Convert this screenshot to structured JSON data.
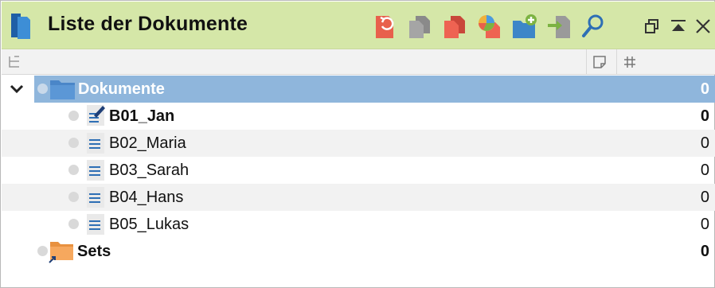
{
  "window": {
    "title": "Liste der Dokumente"
  },
  "toolbar": {
    "icons": [
      "document-activate-icon",
      "copy-documents-icon",
      "multiple-documents-icon",
      "pie-chart-document-icon",
      "new-folder-icon",
      "import-icon",
      "search-icon"
    ]
  },
  "window_controls": {
    "icons": [
      "restore-window-icon",
      "collapse-up-icon",
      "close-icon"
    ]
  },
  "columns": {
    "icons": [
      "tree-structure-icon",
      "memo-icon",
      "hash-icon"
    ]
  },
  "tree": {
    "root": {
      "label": "Dokumente",
      "count": "0",
      "expanded": true,
      "selected": true
    },
    "documents": [
      {
        "label": "B01_Jan",
        "count": "0",
        "bold": true,
        "editing": true
      },
      {
        "label": "B02_Maria",
        "count": "0",
        "bold": false
      },
      {
        "label": "B03_Sarah",
        "count": "0",
        "bold": false
      },
      {
        "label": "B04_Hans",
        "count": "0",
        "bold": false
      },
      {
        "label": "B05_Lukas",
        "count": "0",
        "bold": false
      }
    ],
    "sets": {
      "label": "Sets",
      "count": "0"
    }
  },
  "colors": {
    "titlebar": "#d5e7a8",
    "selection": "#8fb6dc",
    "folder_blue": "#4a86c8",
    "folder_orange": "#f2a65a",
    "doc_icon_blue": "#2e6fb5"
  }
}
